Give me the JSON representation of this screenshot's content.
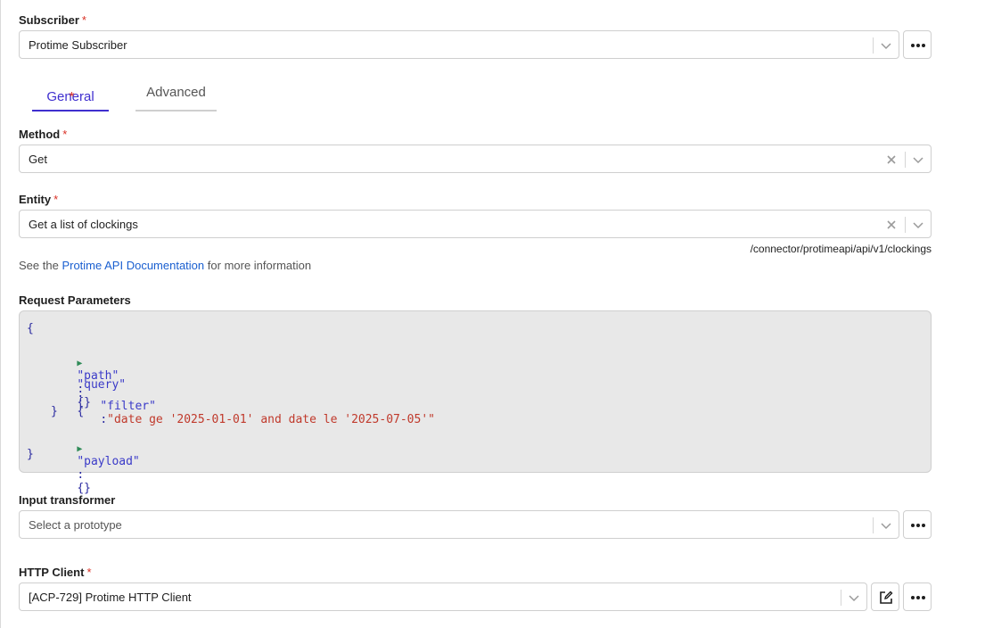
{
  "subscriber": {
    "label": "Subscriber",
    "required_mark": "*",
    "value": "Protime Subscriber"
  },
  "tabs": [
    {
      "label": "General",
      "required_mark": "*",
      "active": true
    },
    {
      "label": "Advanced",
      "active": false
    }
  ],
  "method": {
    "label": "Method",
    "required_mark": "*",
    "value": "Get"
  },
  "entity": {
    "label": "Entity",
    "required_mark": "*",
    "value": "Get a list of clockings",
    "endpoint_path": "/connector/protimeapi/api/v1/clockings"
  },
  "doc_info": {
    "prefix": "See the",
    "link_text": "Protime API Documentation",
    "suffix": "for more information"
  },
  "request_parameters": {
    "label": "Request Parameters",
    "open_brace": "{",
    "close_brace": "}",
    "path_key": "\"path\"",
    "path_value": "{}",
    "query_key": "\"query\"",
    "query_open": "{",
    "query_close": "}",
    "filter_key": "\"filter\"",
    "filter_value": "\"date ge '2025-01-01' and date le '2025-07-05'\"",
    "payload_key": "\"payload\"",
    "payload_value": "{}",
    "colon": ":"
  },
  "input_transformer": {
    "label": "Input transformer",
    "placeholder": "Select a prototype"
  },
  "http_client": {
    "label": "HTTP Client",
    "required_mark": "*",
    "value": "[ACP-729] Protime HTTP Client"
  },
  "colors": {
    "accent": "#3f2fcf",
    "required": "#d93025",
    "link": "#1a5fd0",
    "json_string": "#c0392b",
    "json_key": "#3a3ac8"
  },
  "icons": {
    "more": "more-horizontal-icon",
    "chevron": "chevron-down-icon",
    "clear": "clear-x-icon",
    "edit": "edit-icon",
    "expand": "caret-right-icon"
  }
}
